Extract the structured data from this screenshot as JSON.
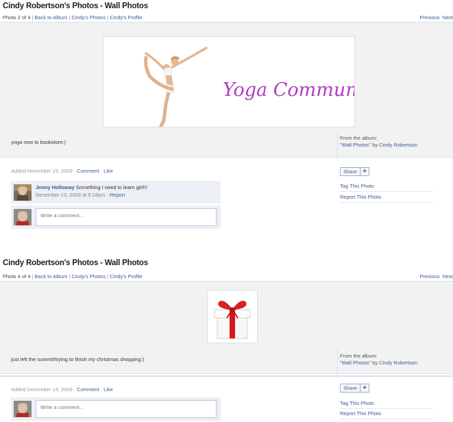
{
  "posts": [
    {
      "title": "Cindy Robertson's Photos - Wall Photos",
      "photo_count": "Photo 2 of 4",
      "nav": {
        "back": "Back to Album",
        "photos": "Cindy's Photos",
        "profile": "Cindy's Profile",
        "sep": "|"
      },
      "previous": "Previous",
      "next": "Next",
      "image_text": "Yoga Community",
      "caption": "yoga now to bookstore:)",
      "album_label": "From the album:",
      "album_name": "\"Wall Photos\"",
      "album_by": "by",
      "album_owner": "Cindy Robertson",
      "added": "Added November 19, 2009",
      "comment_link": "Comment",
      "like_link": "Like",
      "dot": "·",
      "comments": [
        {
          "author": "Jenny Holloway",
          "text": "Something I need to learn girl!!!",
          "date": "December 13, 2009 at 5:18pm",
          "report": "Report"
        }
      ],
      "write_placeholder": "Write a comment...",
      "share_label": "Share",
      "share_plus": "+",
      "tag_label": "Tag This Photo",
      "report_label": "Report This Photo"
    },
    {
      "title": "Cindy Robertson's Photos - Wall Photos",
      "photo_count": "Photo 4 of 4",
      "nav": {
        "back": "Back to Album",
        "photos": "Cindy's Photos",
        "profile": "Cindy's Profile",
        "sep": "|"
      },
      "previous": "Previous",
      "next": "Next",
      "caption": "just left the summit!trying to finish my christmas shopping:)",
      "album_label": "From the album:",
      "album_name": "\"Wall Photos\"",
      "album_by": "by",
      "album_owner": "Cindy Robertson",
      "added": "Added December 14, 2009",
      "comment_link": "Comment",
      "like_link": "Like",
      "dot": "·",
      "write_placeholder": "Write a comment...",
      "share_label": "Share",
      "share_plus": "+",
      "tag_label": "Tag This Photo",
      "report_label": "Report This Photo"
    }
  ],
  "colors": {
    "link": "#3b5998",
    "stage_bg": "#f2f2f2",
    "comment_bg": "#eceff5",
    "yoga_text": "#b03cc0",
    "ribbon": "#d41919"
  }
}
